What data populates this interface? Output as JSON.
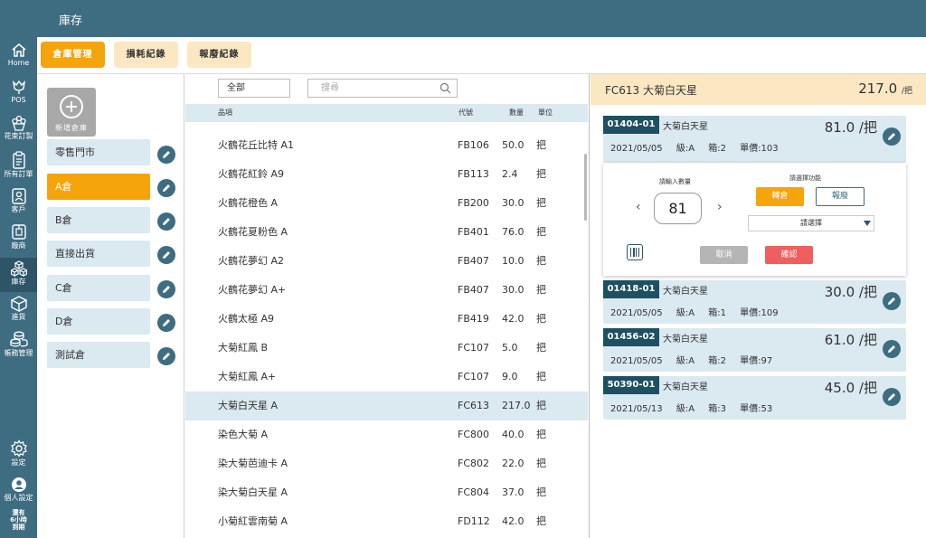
{
  "header": {
    "title": "庫存"
  },
  "nav": {
    "home": "Home",
    "pos": "POS",
    "bouquet": "花束訂製",
    "orders": "所有訂單",
    "customers": "客戶",
    "vendors": "廠商",
    "inventory": "庫存",
    "purchase": "進貨",
    "accounting": "帳務管理",
    "settings": "設定",
    "profile": "個人設定",
    "trial": [
      "還有",
      "6小時",
      "到期"
    ]
  },
  "tabs": [
    "倉庫管理",
    "損耗紀錄",
    "報廢紀錄"
  ],
  "warehouses": {
    "add_label": "新增倉庫",
    "items": [
      "零售門市",
      "A倉",
      "B倉",
      "直接出貨",
      "C倉",
      "D倉",
      "測試倉"
    ]
  },
  "list": {
    "filter": "全部",
    "search_placeholder": "搜尋",
    "headers": {
      "name": "品項",
      "code": "代號",
      "qty": "數量",
      "unit": "單位"
    },
    "rows": [
      [
        "火鶴花丘比特 A1",
        "FB106",
        "50.0",
        "把"
      ],
      [
        "火鶴花紅鈴 A9",
        "FB113",
        "2.4",
        "把"
      ],
      [
        "火鶴花橙色 A",
        "FB200",
        "30.0",
        "把"
      ],
      [
        "火鶴花夏粉色 A",
        "FB401",
        "76.0",
        "把"
      ],
      [
        "火鶴花夢幻 A2",
        "FB407",
        "10.0",
        "把"
      ],
      [
        "火鶴花夢幻 A+",
        "FB407",
        "30.0",
        "把"
      ],
      [
        "火鶴太極 A9",
        "FB419",
        "42.0",
        "把"
      ],
      [
        "大菊紅鳳 B",
        "FC107",
        "5.0",
        "把"
      ],
      [
        "大菊紅鳳 A+",
        "FC107",
        "9.0",
        "把"
      ],
      [
        "大菊白天星 A",
        "FC613",
        "217.0",
        "把"
      ],
      [
        "染色大菊 A",
        "FC800",
        "40.0",
        "把"
      ],
      [
        "染大菊芭迪卡 A",
        "FC802",
        "22.0",
        "把"
      ],
      [
        "染大菊白天星 A",
        "FC804",
        "37.0",
        "把"
      ],
      [
        "小菊紅雲南菊 A",
        "FD112",
        "42.0",
        "把"
      ]
    ]
  },
  "detail": {
    "title": "FC613 大菊白天星",
    "total": "217.0",
    "total_unit": "/把",
    "batches": [
      {
        "code": "01404-01",
        "name": "大菊白天星",
        "qty": "81.0 /把",
        "date": "2021/05/05",
        "grade": "級:A",
        "box": "箱:2",
        "price": "單價:103"
      },
      {
        "code": "01418-01",
        "name": "大菊白天星",
        "qty": "30.0 /把",
        "date": "2021/05/05",
        "grade": "級:A",
        "box": "箱:1",
        "price": "單價:109"
      },
      {
        "code": "01456-02",
        "name": "大菊白天星",
        "qty": "61.0 /把",
        "date": "2021/05/05",
        "grade": "級:A",
        "box": "箱:2",
        "price": "單價:97"
      },
      {
        "code": "50390-01",
        "name": "大菊白天星",
        "qty": "45.0 /把",
        "date": "2021/05/13",
        "grade": "級:A",
        "box": "箱:3",
        "price": "單價:53"
      }
    ],
    "panel": {
      "qty_label": "請輸入數量",
      "qty_value": "81",
      "func_label": "請選擇功能",
      "transfer": "轉倉",
      "scrap": "報廢",
      "select_placeholder": "請選擇",
      "cancel": "取消",
      "confirm": "確認"
    }
  }
}
